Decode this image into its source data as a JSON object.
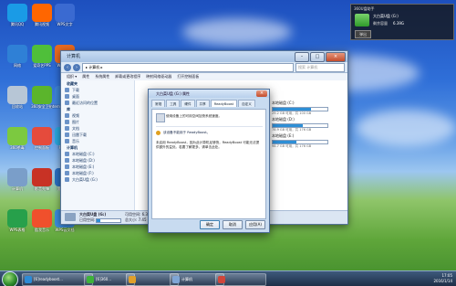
{
  "desktop_icons": [
    {
      "label": "腾讯QQ",
      "color": "#1a9be6"
    },
    {
      "label": "腾讯视频",
      "color": "#ff6600"
    },
    {
      "label": "WPS文字",
      "color": "#3a6ad1"
    },
    {
      "label": "网络",
      "color": "#2f80d6"
    },
    {
      "label": "爱奇艺PPS",
      "color": "#4fbf3a"
    },
    {
      "label": "WPS演示",
      "color": "#e86a1f"
    },
    {
      "label": "回收站",
      "color": "#b7c6d6"
    },
    {
      "label": "360安全卫士",
      "color": "#5bb52c"
    },
    {
      "label": "Internet Explorer",
      "color": "#3d86d8"
    },
    {
      "label": "360杀毒",
      "color": "#7cc940"
    },
    {
      "label": "控制面板",
      "color": "#e54b3c"
    },
    {
      "label": "PP助手",
      "color": "#2aa8e0"
    },
    {
      "label": "计算机",
      "color": "#7a9ec9"
    },
    {
      "label": "影音先锋",
      "color": "#c83225"
    },
    {
      "label": "宽带连接",
      "color": "#2b6fc2"
    },
    {
      "label": "WPS表格",
      "color": "#27a04b"
    },
    {
      "label": "酷我音乐",
      "color": "#f0502c"
    },
    {
      "label": "WPS云文档",
      "color": "#3c8de0"
    }
  ],
  "gadget": {
    "title": "360U盘助手",
    "drive": "大白菜U盘 (G:)",
    "free_label": "剩余容量",
    "free_value": "6.39G",
    "eject": "弹出"
  },
  "explorer": {
    "title": "计算机",
    "address": "▸ 计算机 ▸",
    "search_placeholder": "搜索 计算机",
    "menu": [
      "组织 ▾",
      "属性",
      "系统属性",
      "卸载或更改程序",
      "映射网络驱动器",
      "打开控制面板"
    ],
    "sidebar": [
      {
        "label": "收藏夹",
        "header": true
      },
      {
        "label": "下载",
        "header": false
      },
      {
        "label": "桌面",
        "header": false
      },
      {
        "label": "最近访问的位置",
        "header": false
      },
      {
        "label": "库",
        "header": true
      },
      {
        "label": "视频",
        "header": false
      },
      {
        "label": "图片",
        "header": false
      },
      {
        "label": "文档",
        "header": false
      },
      {
        "label": "迅雷下载",
        "header": false
      },
      {
        "label": "音乐",
        "header": false
      },
      {
        "label": "计算机",
        "header": true
      },
      {
        "label": "本地磁盘 (C:)",
        "header": false
      },
      {
        "label": "本地磁盘 (D:)",
        "header": false
      },
      {
        "label": "本地磁盘 (E:)",
        "header": false
      },
      {
        "label": "本地磁盘 (F:)",
        "header": false
      },
      {
        "label": "大白菜U盘 (G:)",
        "header": false
      }
    ],
    "drives": [
      {
        "name": "本地磁盘 (C:)",
        "size": "29.2 GB 可用，共 100 GB",
        "fill": 0.7
      },
      {
        "name": "本地磁盘 (D:)",
        "size": "78.9 GB 可用，共 176 GB",
        "fill": 0.55
      },
      {
        "name": "本地磁盘 (E:)",
        "size": "98.7 GB 可用，共 176 GB",
        "fill": 0.44
      }
    ],
    "status": {
      "name": "大白菜U盘 (G:)",
      "used_label": "已用空间:",
      "free_label": "可用空间: 6.39 GB",
      "total": "总大小: 7.45 GB",
      "fs": "文件系统: FAT32"
    }
  },
  "dialog": {
    "title": "大白菜U盘 (G:) 属性",
    "close": "×",
    "tabs": [
      "常规",
      "工具",
      "硬件",
      "共享",
      "ReadyBoost",
      "自定义"
    ],
    "active_tab": 4,
    "header_text": "使用设备上的可用空间加快系统速度。",
    "radio_label": "不使用此设备(O)",
    "option2": "该设备不能用于 ReadyBoost。",
    "info_text": "未启用 ReadyBoost，因为此计算机足够快，ReadyBoost 可能无法提供额外的益处。若要了解更多，请单击此处。",
    "link": "若要启用请单击",
    "buttons": {
      "ok": "确定",
      "cancel": "取消",
      "apply": "应用(A)"
    }
  },
  "taskbar": {
    "items": [
      {
        "label": "[6]readyboost...",
        "color": "#2d8bd6"
      },
      {
        "label": "[6]360...",
        "color": "#3db33a"
      },
      {
        "label": "",
        "color": "#e0a02a"
      },
      {
        "label": "计算机",
        "color": "#7fa6d6"
      },
      {
        "label": "",
        "color": "#d0463b"
      }
    ],
    "tray_time": "17:05",
    "tray_date": "2016/1/14"
  }
}
